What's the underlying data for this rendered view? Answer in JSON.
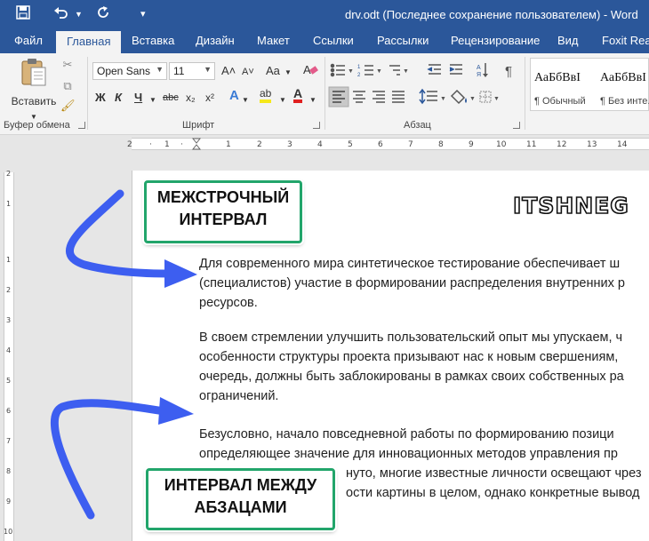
{
  "titlebar": {
    "doc_title": "drv.odt (Последнее сохранение пользователем) - Word",
    "save_icon": "save-icon",
    "undo_icon": "undo-icon",
    "redo_icon": "redo-icon"
  },
  "tabs": [
    "Файл",
    "Главная",
    "Вставка",
    "Дизайн",
    "Макет",
    "Ссылки",
    "Рассылки",
    "Рецензирование",
    "Вид",
    "Foxit Read"
  ],
  "clipboard": {
    "paste_label": "Вставить",
    "group_label": "Буфер обмена"
  },
  "font": {
    "name": "Open Sans",
    "size": "11",
    "grow": "A˄",
    "shrink": "A˅",
    "case": "Aa",
    "bold": "Ж",
    "italic": "К",
    "underline": "Ч",
    "strike": "abc",
    "sub": "x₂",
    "sup": "x²",
    "effects": "A",
    "highlight": "ab",
    "color": "A",
    "group_label": "Шрифт"
  },
  "paragraph": {
    "group_label": "Абзац"
  },
  "styles": [
    {
      "sample": "АаБбВвІ",
      "name": "¶ Обычный"
    },
    {
      "sample": "АаБбВвІ",
      "name": "¶ Без инте..."
    }
  ],
  "document": {
    "logo": "ITSHNEG",
    "paragraphs": [
      [
        "Для современного мира синтетическое тестирование обеспечивает ш",
        "(специалистов) участие в формировании распределения внутренних р",
        "ресурсов."
      ],
      [
        "В своем стремлении улучшить пользовательский опыт мы упускаем, ч",
        "особенности структуры проекта призывают нас к новым свершениям,",
        "очередь, должны быть заблокированы в рамках своих собственных ра",
        "ограничений."
      ],
      [
        "Безусловно, начало повседневной работы по формированию позици",
        "определяющее значение для инновационных методов управления пр",
        "нуто, многие известные личности освещают чрез",
        "ости картины в целом, однако конкретные вывод"
      ]
    ]
  },
  "callouts": {
    "line_spacing": [
      "МЕЖСТРОЧНЫЙ",
      "ИНТЕРВАЛ"
    ],
    "para_spacing": [
      "ИНТЕРВАЛ МЕЖДУ",
      "АБЗАЦАМИ"
    ]
  },
  "colors": {
    "word_blue": "#2b579a",
    "arrow_blue": "#3d5ef0",
    "callout_border": "#22a56b"
  }
}
